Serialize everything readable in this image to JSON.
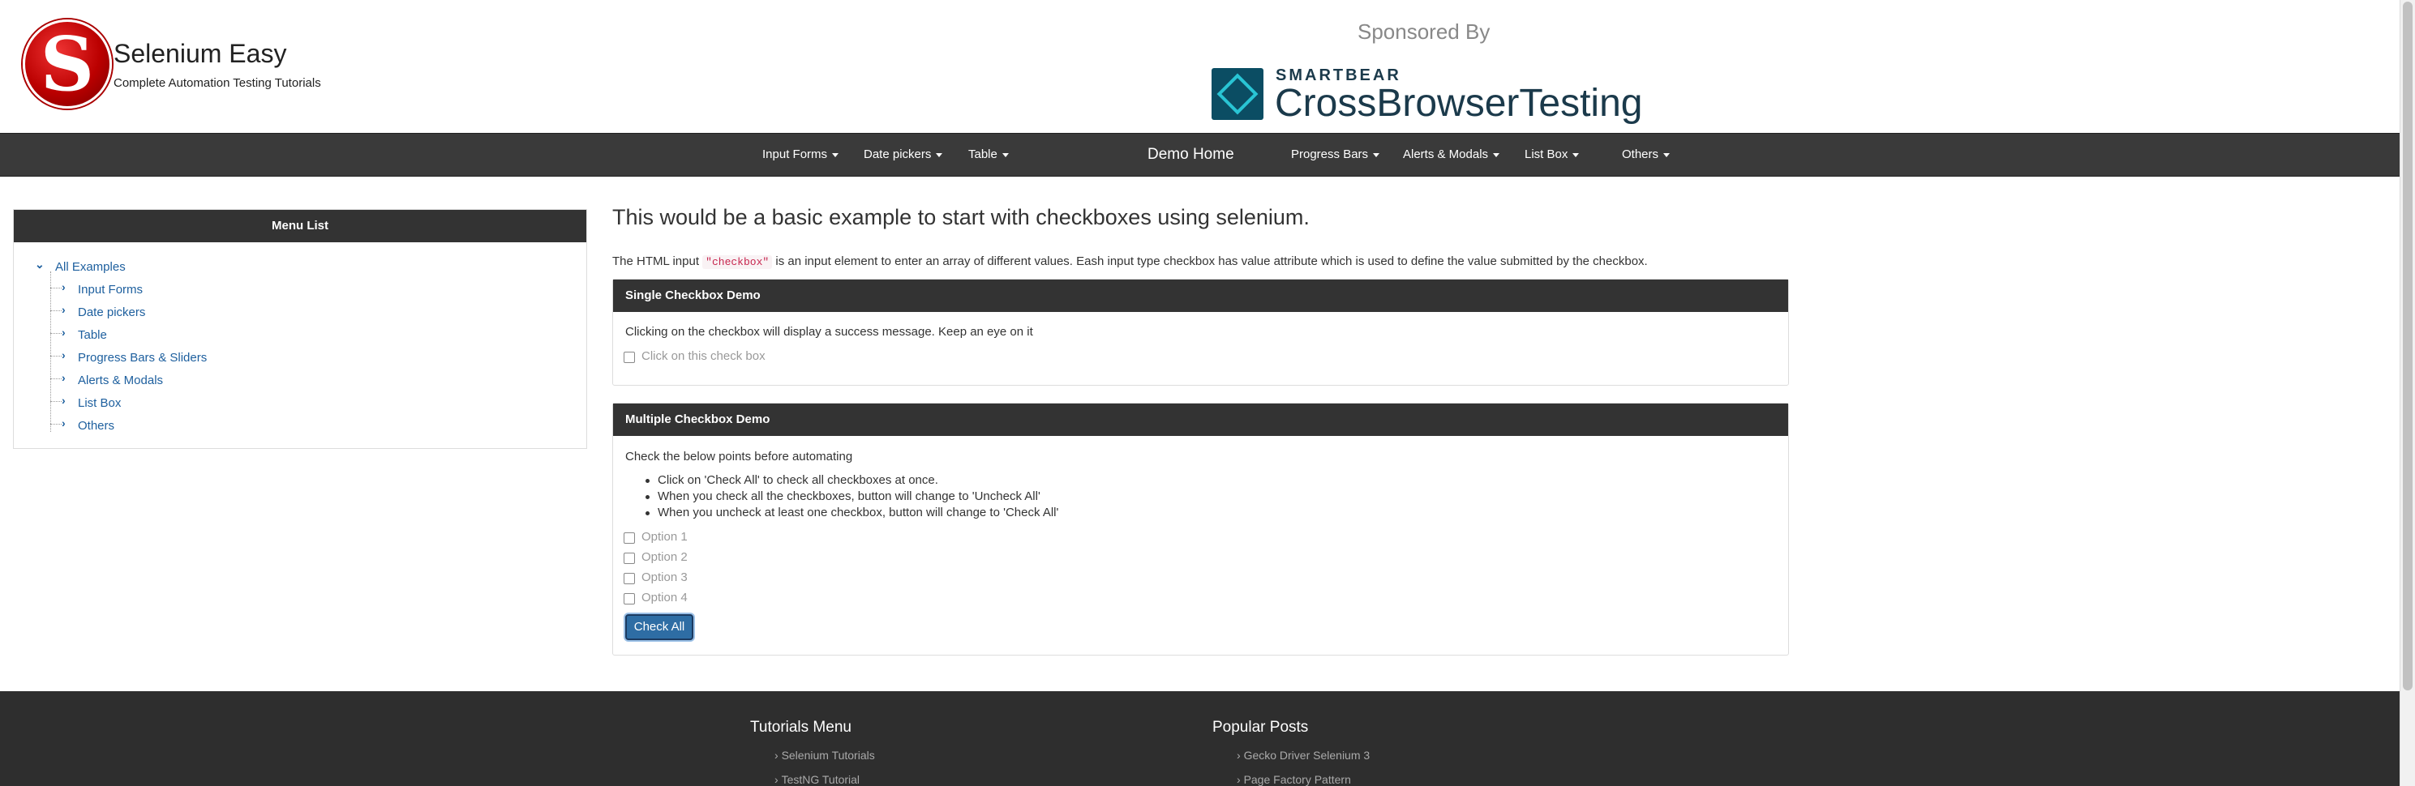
{
  "header": {
    "brand_title": "Selenium Easy",
    "brand_subtitle": "Complete Automation Testing Tutorials",
    "logo_letter": "S",
    "sponsored_label": "Sponsored By",
    "sponsor_small": "SMARTBEAR",
    "sponsor_big": "CrossBrowserTesting"
  },
  "nav": {
    "items": [
      {
        "label": "Input Forms"
      },
      {
        "label": "Date pickers"
      },
      {
        "label": "Table"
      },
      {
        "label": "Demo Home"
      },
      {
        "label": "Progress Bars"
      },
      {
        "label": "Alerts & Modals"
      },
      {
        "label": "List Box"
      },
      {
        "label": "Others"
      }
    ]
  },
  "sidebar": {
    "title": "Menu List",
    "root": "All Examples",
    "items": [
      {
        "label": "Input Forms"
      },
      {
        "label": "Date pickers"
      },
      {
        "label": "Table"
      },
      {
        "label": "Progress Bars & Sliders"
      },
      {
        "label": "Alerts & Modals"
      },
      {
        "label": "List Box"
      },
      {
        "label": "Others"
      }
    ]
  },
  "main": {
    "heading": "This would be a basic example to start with checkboxes using selenium.",
    "intro_before": "The HTML input",
    "intro_code": "\"checkbox\"",
    "intro_after": "is an input element to enter an array of different values. Eash input type checkbox has value attribute which is used to define the value submitted by the checkbox."
  },
  "single_panel": {
    "title": "Single Checkbox Demo",
    "description": "Clicking on the checkbox will display a success message. Keep an eye on it",
    "checkbox_label": "Click on this check box"
  },
  "multi_panel": {
    "title": "Multiple Checkbox Demo",
    "description": "Check the below points before automating",
    "points": [
      "Click on 'Check All' to check all checkboxes at once.",
      "When you check all the checkboxes, button will change to 'Uncheck All'",
      "When you uncheck at least one checkbox, button will change to 'Check All'"
    ],
    "options": [
      "Option 1",
      "Option 2",
      "Option 3",
      "Option 4"
    ],
    "button_label": "Check All"
  },
  "footer": {
    "col1_title": "Tutorials Menu",
    "col1_links": [
      "Selenium Tutorials",
      "TestNG Tutorial"
    ],
    "col2_title": "Popular Posts",
    "col2_links": [
      "Gecko Driver Selenium 3",
      "Page Factory Pattern"
    ]
  }
}
